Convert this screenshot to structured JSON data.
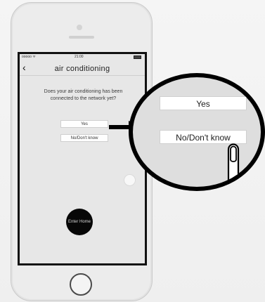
{
  "status_bar": {
    "carrier": "ooooo ᯤ",
    "time": "21:00"
  },
  "nav": {
    "back_icon": "‹",
    "title": "air conditioning"
  },
  "prompt": {
    "question": "Does your air conditioning has been connected to the network yet?"
  },
  "buttons": {
    "yes": "Yes",
    "no": "No/Don't know",
    "enter_home": "Enter Home"
  },
  "zoom": {
    "yes": "Yes",
    "no": "No/Don't know"
  },
  "icons": {
    "arrow": "right-arrow-icon",
    "finger": "finger-tap-icon",
    "back": "back-chevron-icon"
  }
}
